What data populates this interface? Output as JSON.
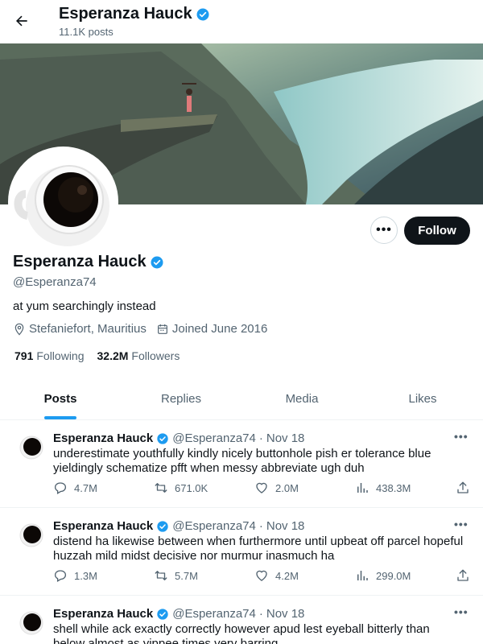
{
  "header": {
    "name": "Esperanza Hauck",
    "posts_count": "11.1K posts"
  },
  "profile": {
    "name": "Esperanza Hauck",
    "handle": "@Esperanza74",
    "bio": "at yum searchingly instead",
    "location": "Stefaniefort, Mauritius",
    "joined": "Joined June 2016",
    "following_count": "791",
    "following_label": "Following",
    "followers_count": "32.2M",
    "followers_label": "Followers",
    "follow_label": "Follow",
    "more_label": "•••"
  },
  "tabs": [
    {
      "label": "Posts"
    },
    {
      "label": "Replies"
    },
    {
      "label": "Media"
    },
    {
      "label": "Likes"
    }
  ],
  "tweets": [
    {
      "author": "Esperanza Hauck",
      "handle": "@Esperanza74",
      "dot": "·",
      "date": "Nov 18",
      "text": "underestimate youthfully kindly nicely buttonhole pish er tolerance blue yieldingly schematize pfft when messy abbreviate ugh duh",
      "replies": "4.7M",
      "retweets": "671.0K",
      "likes": "2.0M",
      "views": "438.3M",
      "more": "•••"
    },
    {
      "author": "Esperanza Hauck",
      "handle": "@Esperanza74",
      "dot": "·",
      "date": "Nov 18",
      "text": "distend ha likewise between when furthermore until upbeat off parcel hopeful huzzah mild midst decisive nor murmur inasmuch ha",
      "replies": "1.3M",
      "retweets": "5.7M",
      "likes": "4.2M",
      "views": "299.0M",
      "more": "•••"
    },
    {
      "author": "Esperanza Hauck",
      "handle": "@Esperanza74",
      "dot": "·",
      "date": "Nov 18",
      "text": "shell while ack exactly correctly however apud lest eyeball bitterly than below almost as yippee times very barring",
      "more": "•••"
    }
  ],
  "colors": {
    "accent": "#1d9bf0",
    "text": "#0f1419",
    "muted": "#536471"
  }
}
